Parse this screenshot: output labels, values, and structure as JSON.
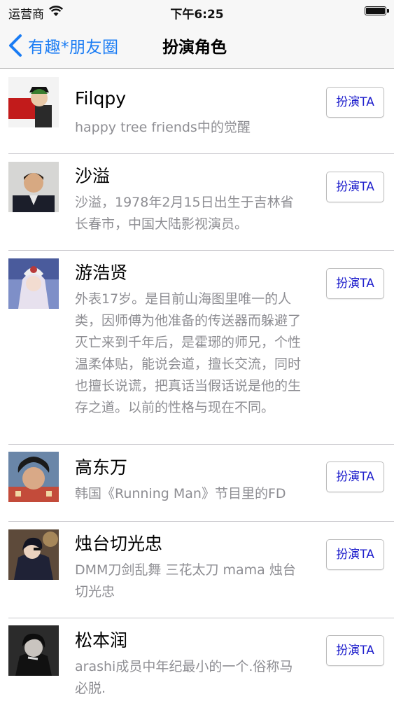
{
  "status_bar": {
    "carrier": "运营商",
    "time": "下午6:25",
    "wifi_icon": "wifi-icon",
    "battery_icon": "battery-icon"
  },
  "nav": {
    "back_label": "有趣*朋友圈",
    "back_icon": "chevron-left-icon",
    "title": "扮演角色",
    "accent_color": "#1a7cf4"
  },
  "characters": [
    {
      "name": "Filqpy",
      "desc": "happy tree friends中的觉醒",
      "button": "扮演TA"
    },
    {
      "name": "沙溢",
      "desc": "沙溢，1978年2月15日出生于吉林省长春市，中国大陆影视演员。",
      "button": "扮演TA"
    },
    {
      "name": "游浩贤",
      "desc": "外表17岁。是目前山海图里唯一的人类，因师傅为他准备的传送器而躲避了灭亡来到千年后，是霍琊的师兄，个性温柔体贴，能说会道，擅长交流，同时也擅长说谎，把真话当假话说是他的生存之道。以前的性格与现在不同。",
      "button": "扮演TA"
    },
    {
      "name": "高东万",
      "desc": "韩国《Running Man》节目里的FD",
      "button": "扮演TA"
    },
    {
      "name": "烛台切光忠",
      "desc": "DMM刀剑乱舞 三花太刀 mama 烛台切光忠",
      "button": "扮演TA"
    },
    {
      "name": "松本润",
      "desc": "arashi成员中年纪最小的一个.俗称马必脱.",
      "button": "扮演TA"
    }
  ]
}
